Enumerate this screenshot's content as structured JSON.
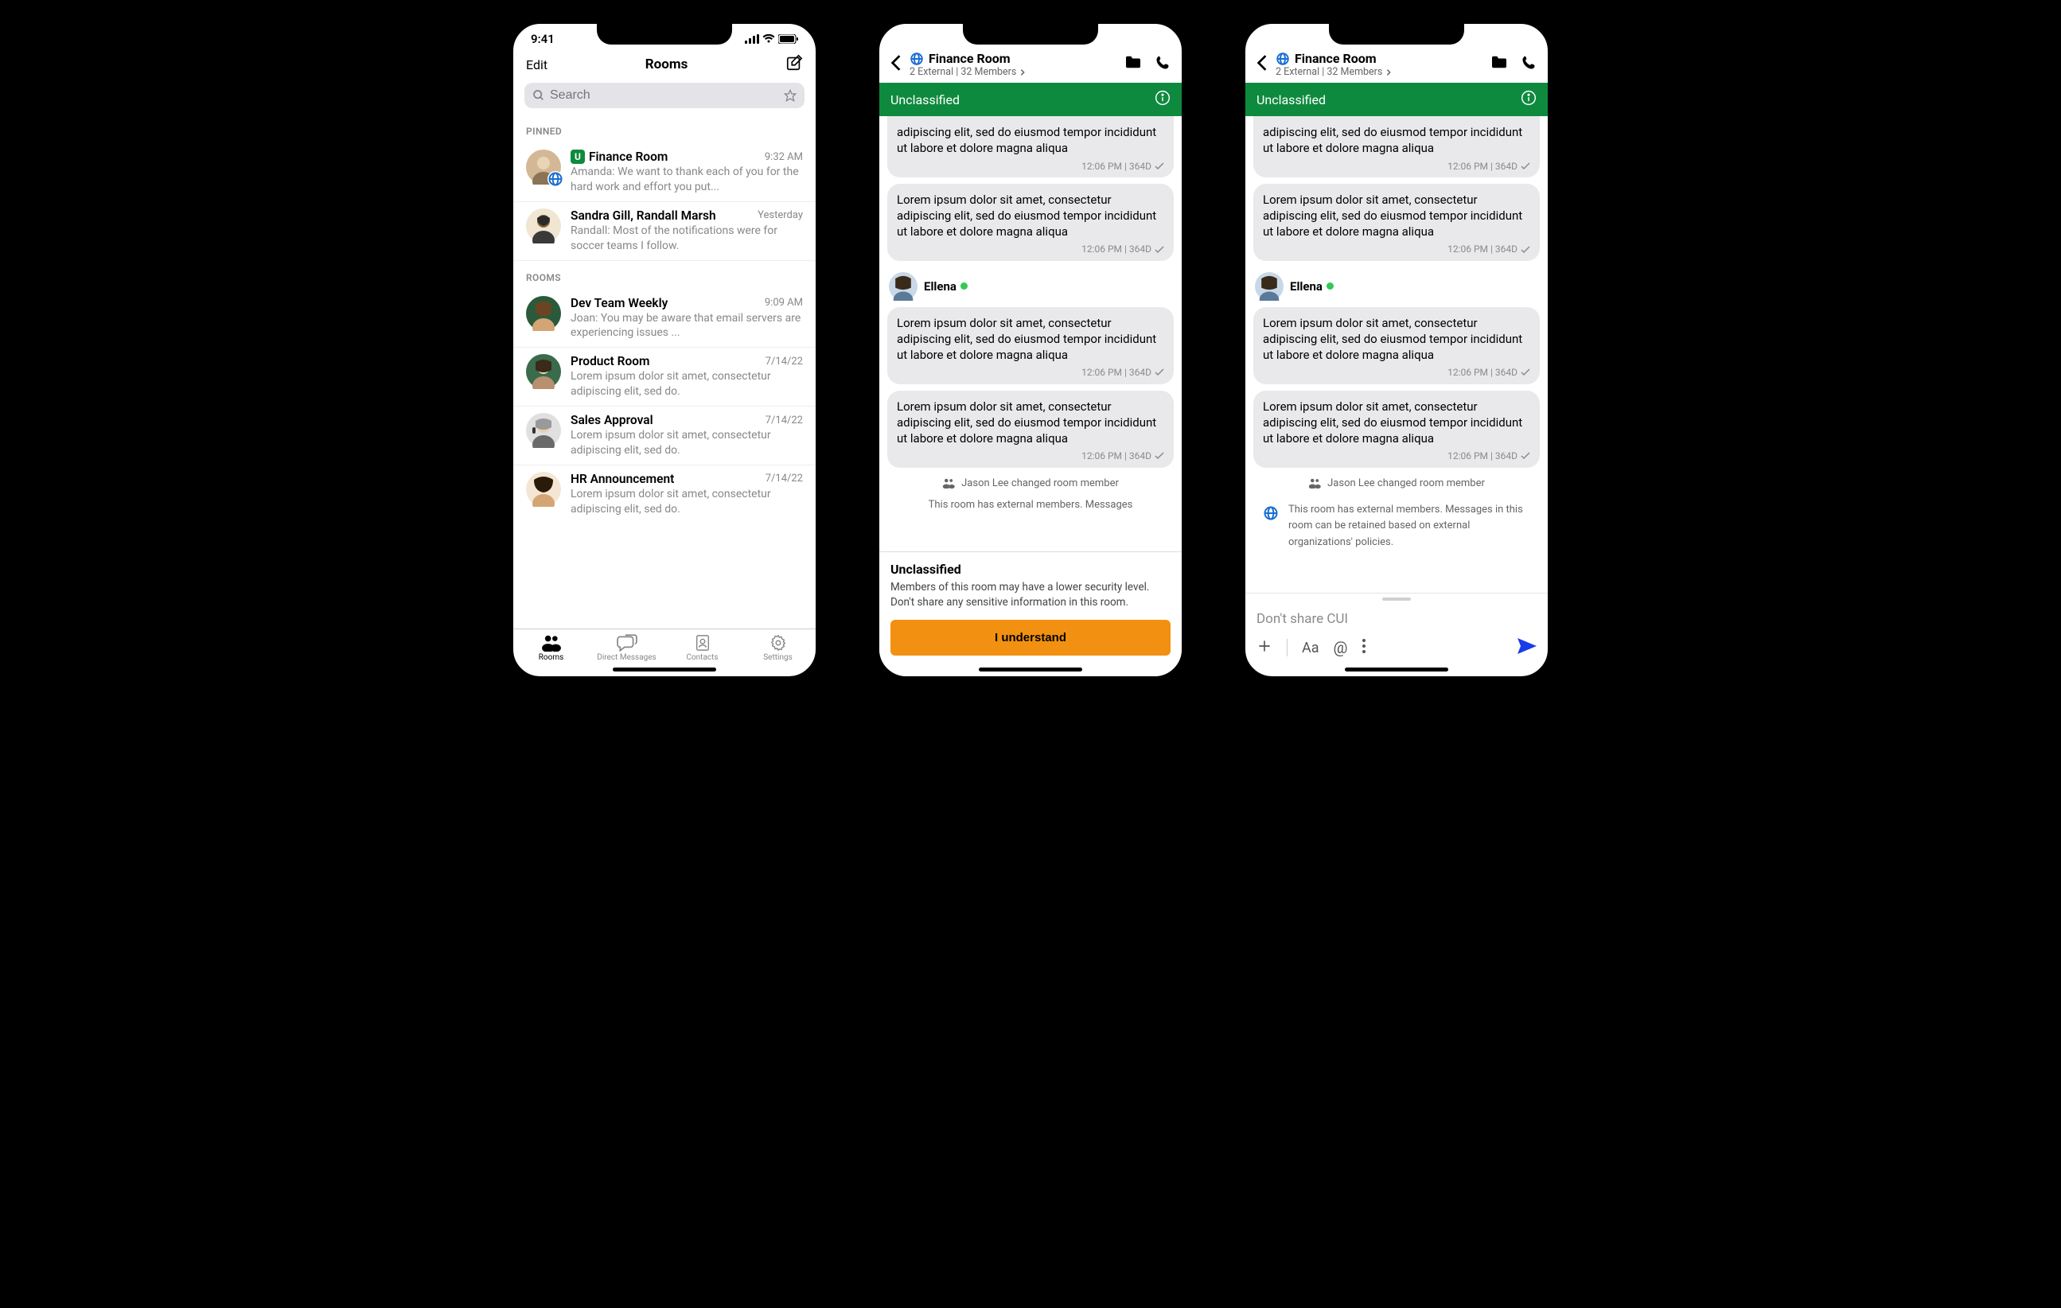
{
  "status": {
    "time": "9:41"
  },
  "screen1": {
    "edit": "Edit",
    "title": "Rooms",
    "search_placeholder": "Search",
    "section_pinned": "PINNED",
    "section_rooms": "ROOMS",
    "pinned": [
      {
        "title": "Finance Room",
        "time": "9:32 AM",
        "preview": "Amanda: We want to thank each of you for the hard work and effort you put...",
        "has_u_badge": true,
        "has_globe": true
      },
      {
        "title": "Sandra Gill, Randall Marsh",
        "time": "Yesterday",
        "preview": "Randall: Most of the notifications were for soccer teams I follow."
      }
    ],
    "rooms": [
      {
        "title": "Dev Team Weekly",
        "time": "9:09 AM",
        "preview": "Joan: You may be aware that email servers are experiencing issues ..."
      },
      {
        "title": "Product Room",
        "time": "7/14/22",
        "preview": "Lorem ipsum dolor sit amet, consectetur adipiscing elit, sed do."
      },
      {
        "title": "Sales Approval",
        "time": "7/14/22",
        "preview": "Lorem ipsum dolor sit amet, consectetur adipiscing elit, sed do."
      },
      {
        "title": "HR Announcement",
        "time": "7/14/22",
        "preview": "Lorem ipsum dolor sit amet, consectetur adipiscing elit, sed do."
      }
    ],
    "tabs": {
      "rooms": "Rooms",
      "direct": "Direct Messages",
      "contacts": "Contacts",
      "settings": "Settings"
    }
  },
  "chat": {
    "title": "Finance Room",
    "subtitle": "2 External  |  32 Members",
    "classification": "Unclassified",
    "msg_partial": "adipiscing elit, sed do eiusmod tempor incididunt ut labore et dolore magna aliqua",
    "msg_full": "Lorem ipsum dolor sit amet, consectetur adipiscing elit, sed do eiusmod tempor incididunt ut labore et dolore magna aliqua",
    "msg_meta": "12:06 PM | 364D",
    "sender": "Ellena",
    "system_msg": "Jason Lee changed room member",
    "external_notice_short": "This room has external members. Messages",
    "external_notice_full": "This room has external members. Messages in this room can be retained based on external organizations' policies.",
    "sheet_title": "Unclassified",
    "sheet_body": "Members of this room may have a lower security level. Don't share any sensitive information in this room.",
    "sheet_button": "I understand",
    "composer_placeholder": "Don't share CUI"
  },
  "colors": {
    "classification_green": "#0e8a3e",
    "accent_orange": "#f29111",
    "send_blue": "#1a3de8"
  }
}
